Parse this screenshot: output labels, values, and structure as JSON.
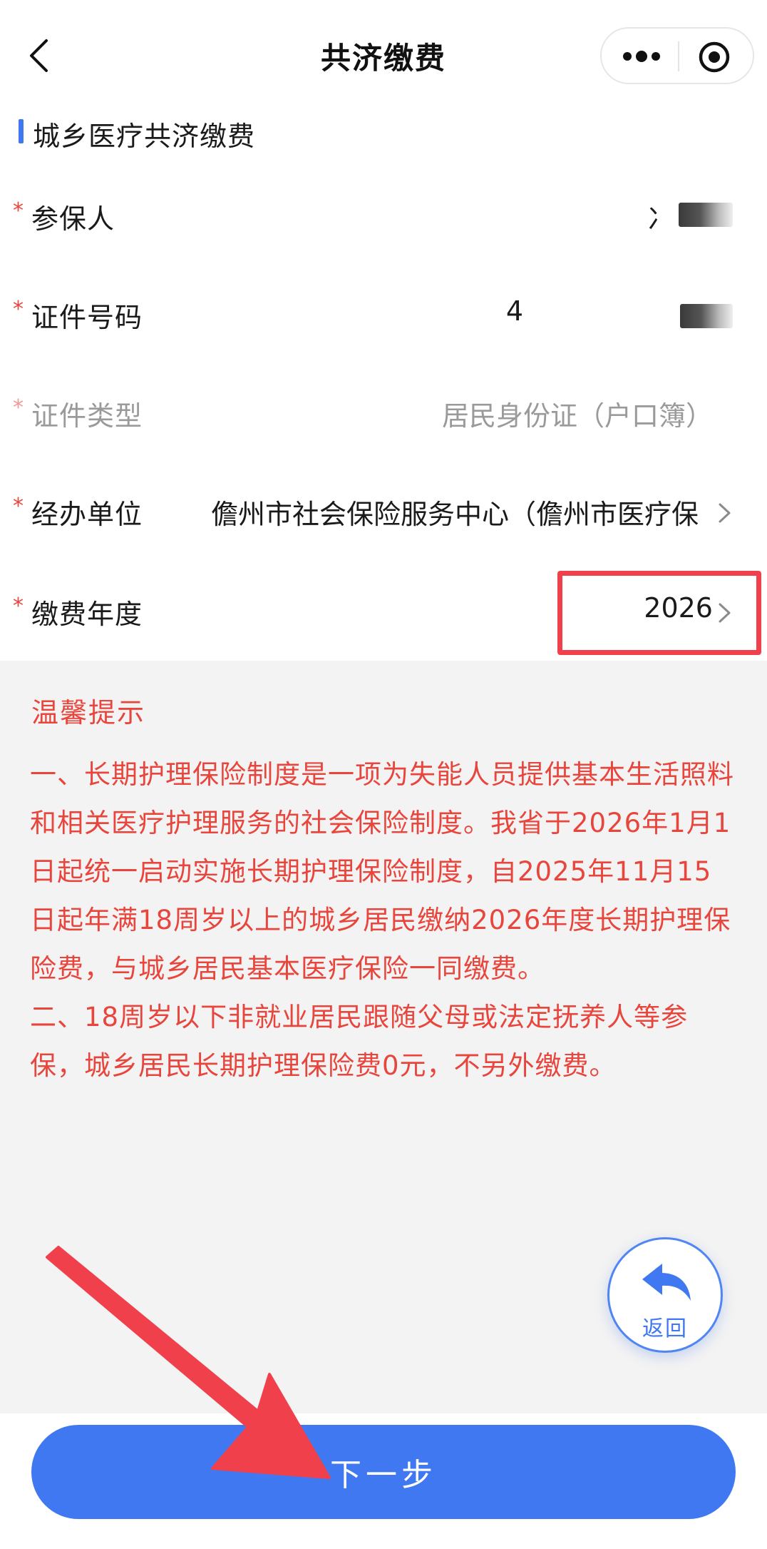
{
  "nav": {
    "title": "共济缴费"
  },
  "section": {
    "title": "城乡医疗共济缴费"
  },
  "form": {
    "insured": {
      "label": "参保人",
      "value": "冫"
    },
    "id_number": {
      "label": "证件号码",
      "value": "4"
    },
    "id_type": {
      "label": "证件类型",
      "value": "居民身份证（户口簿）"
    },
    "agency": {
      "label": "经办单位",
      "value": "儋州市社会保险服务中心（儋州市医疗保"
    },
    "year": {
      "label": "缴费年度",
      "value": "2026"
    },
    "required_mark": "*"
  },
  "notice": {
    "title": "温馨提示",
    "paragraph1": "一、长期护理保险制度是一项为失能人员提供基本生活照料和相关医疗护理服务的社会保险制度。我省于2026年1月1日起统一启动实施长期护理保险制度，自2025年11月15日起年满18周岁以上的城乡居民缴纳2026年度长期护理保险费，与城乡居民基本医疗保险一同缴费。",
    "paragraph2": "二、18周岁以下非就业居民跟随父母或法定抚养人等参保，城乡居民长期护理保险费0元，不另外缴费。"
  },
  "return_button": {
    "label": "返回"
  },
  "next_button": {
    "label": "下一步"
  },
  "colors": {
    "accent": "#3f78f0",
    "notice_text": "#e8453c",
    "annotation": "#f0404b"
  }
}
